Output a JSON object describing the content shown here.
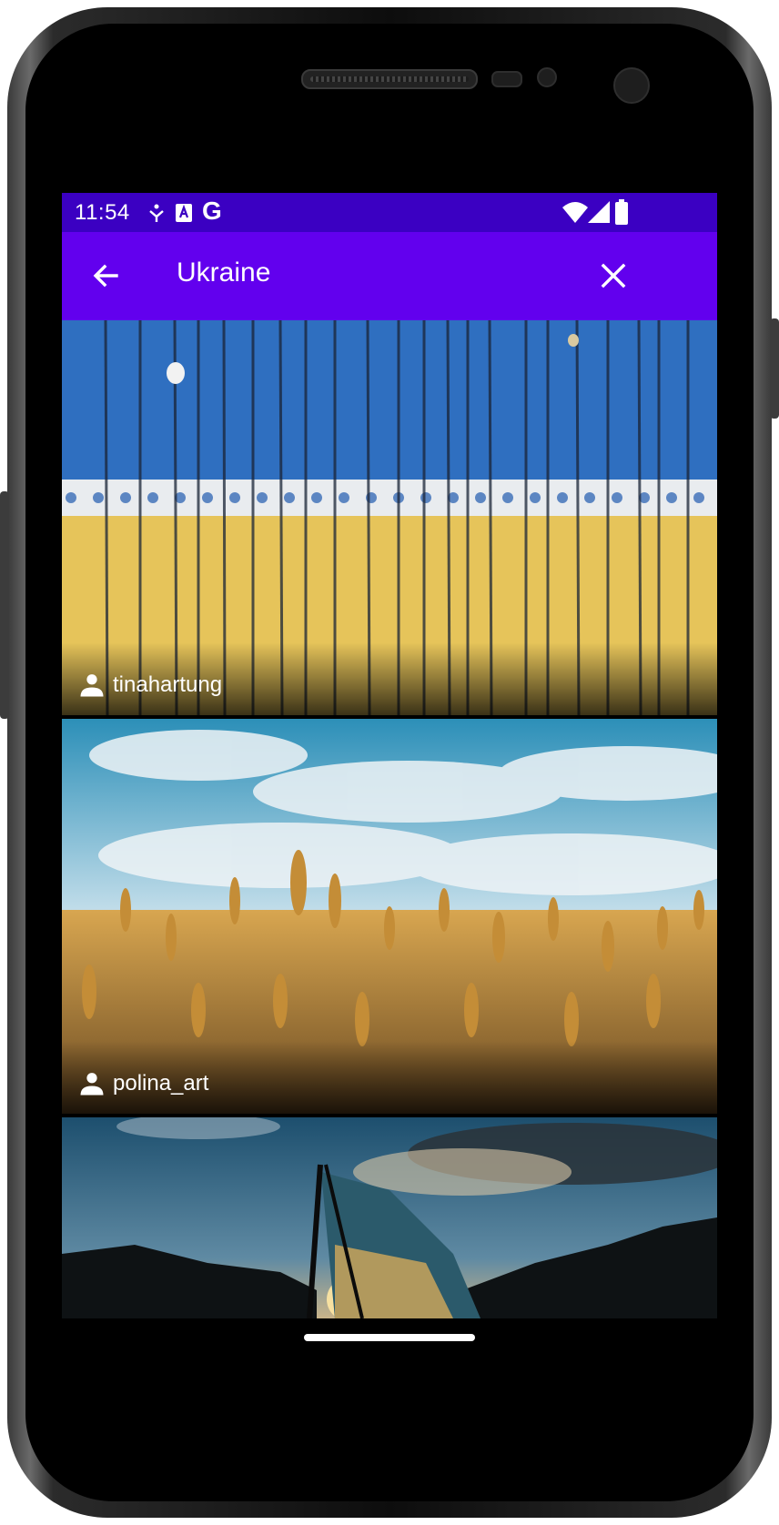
{
  "status_bar": {
    "time": "11:54",
    "left_icons": [
      "fitness-icon",
      "accessibility-icon",
      "google-icon"
    ],
    "right_icons": [
      "wifi-icon",
      "cell-signal-icon",
      "battery-icon"
    ],
    "google_letter": "G"
  },
  "app_bar": {
    "search_query": "Ukraine",
    "back_icon": "arrow-back-icon",
    "clear_icon": "close-icon",
    "background_color": "#6200ee",
    "status_color": "#3b00c2"
  },
  "results": [
    {
      "author": "tinahartung",
      "scene": "blue-yellow-fence"
    },
    {
      "author": "polina_art",
      "scene": "wheat-field"
    },
    {
      "author": "",
      "scene": "flag-sunset"
    }
  ]
}
